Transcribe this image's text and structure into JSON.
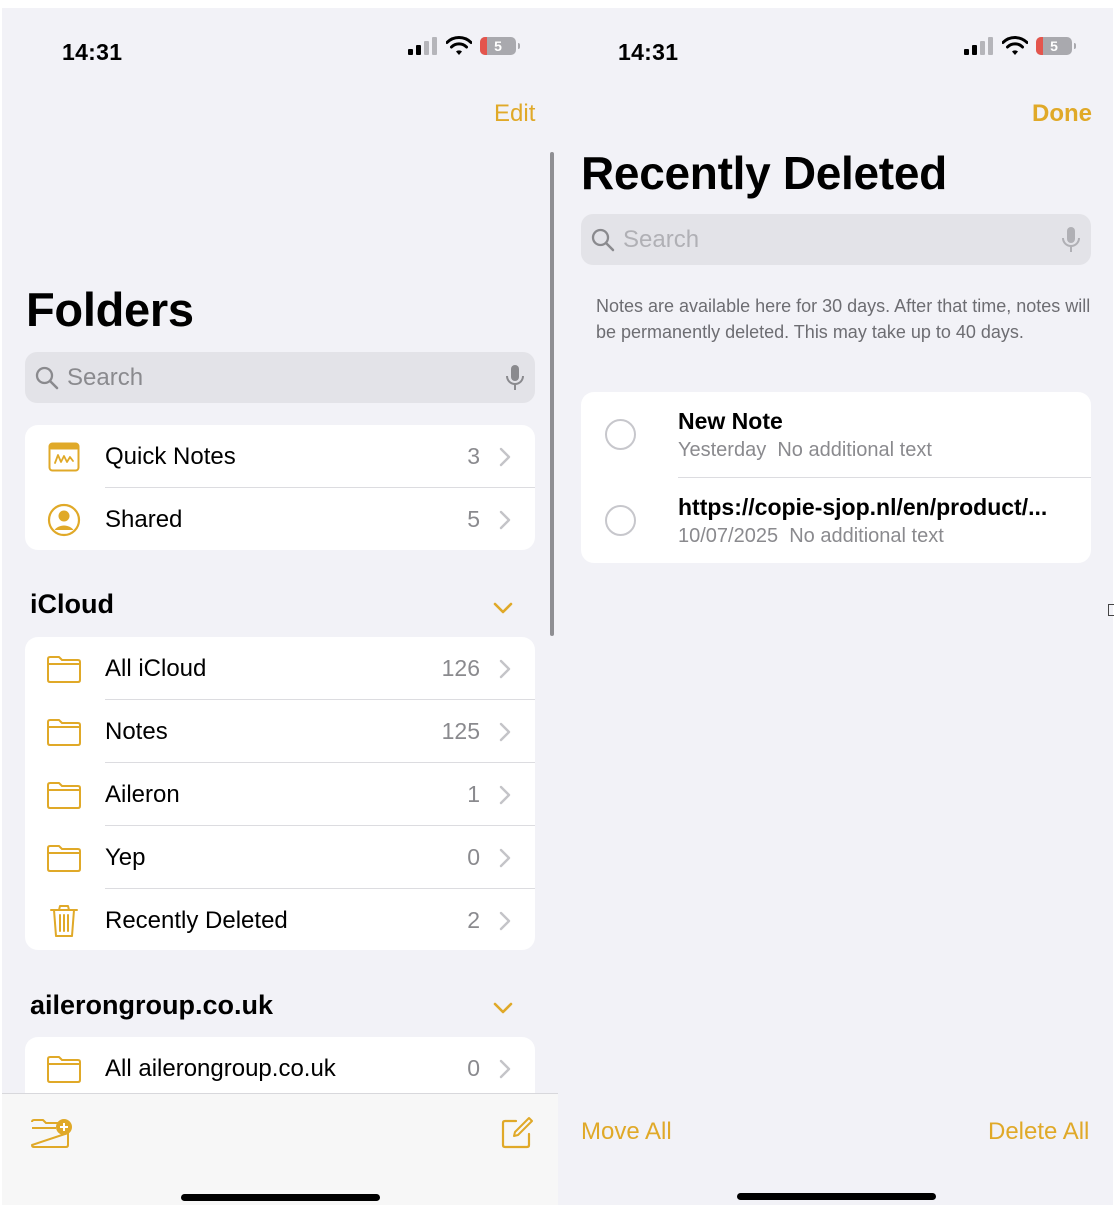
{
  "colors": {
    "accent": "#e0a928",
    "background": "#f2f2f7",
    "card": "#ffffff",
    "secondary_text": "#8a8a8e"
  },
  "left": {
    "status": {
      "time": "14:31",
      "battery": "5"
    },
    "nav": {
      "edit_label": "Edit"
    },
    "title": "Folders",
    "search": {
      "placeholder": "Search"
    },
    "pinned": [
      {
        "label": "Quick Notes",
        "count": "3",
        "icon": "quick-notes-icon"
      },
      {
        "label": "Shared",
        "count": "5",
        "icon": "shared-person-icon"
      }
    ],
    "sections": [
      {
        "title": "iCloud",
        "items": [
          {
            "label": "All iCloud",
            "count": "126",
            "icon": "folder-icon"
          },
          {
            "label": "Notes",
            "count": "125",
            "icon": "folder-icon"
          },
          {
            "label": "Aileron",
            "count": "1",
            "icon": "folder-icon"
          },
          {
            "label": "Yep",
            "count": "0",
            "icon": "folder-icon"
          },
          {
            "label": "Recently Deleted",
            "count": "2",
            "icon": "trash-icon"
          }
        ]
      },
      {
        "title": "ailerongroup.co.uk",
        "items": [
          {
            "label": "All ailerongroup.co.uk",
            "count": "0",
            "icon": "folder-icon"
          }
        ]
      }
    ],
    "toolbar": {
      "new_folder_icon": "new-folder-icon",
      "compose_icon": "compose-icon"
    }
  },
  "right": {
    "status": {
      "time": "14:31",
      "battery": "5"
    },
    "nav": {
      "done_label": "Done"
    },
    "title": "Recently Deleted",
    "search": {
      "placeholder": "Search"
    },
    "info": "Notes are available here for 30 days. After that time, notes will be permanently deleted. This may take up to 40 days.",
    "notes": [
      {
        "title": "New Note",
        "date": "Yesterday",
        "preview": "No additional text"
      },
      {
        "title": "https://copie-sjop.nl/en/product/...",
        "date": "10/07/2025",
        "preview": "No additional text"
      }
    ],
    "bottom": {
      "move_all": "Move All",
      "delete_all": "Delete All"
    }
  }
}
